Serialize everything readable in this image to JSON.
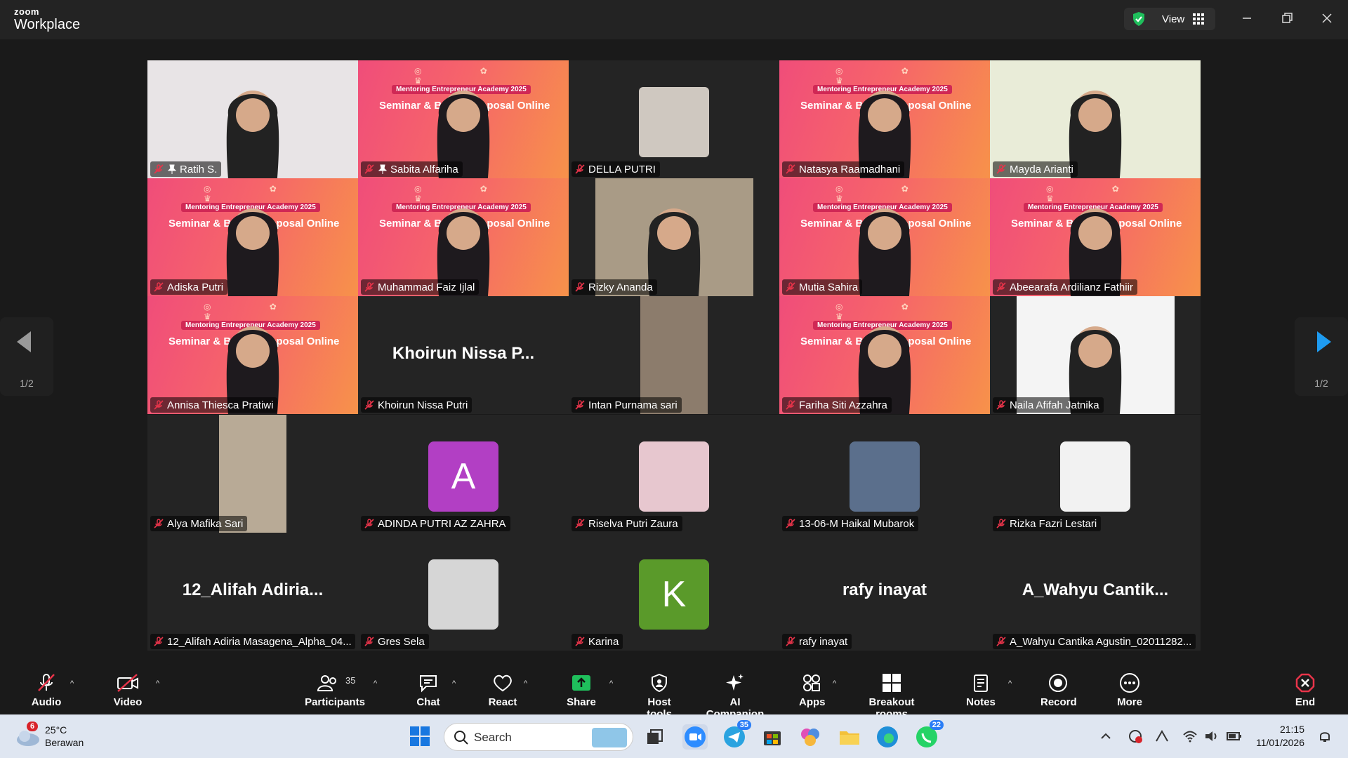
{
  "app": {
    "brand_top": "zoom",
    "brand_bottom": "Workplace",
    "view_label": "View"
  },
  "pager": {
    "left": "1/2",
    "right": "1/2"
  },
  "banner": {
    "line1": "Mentoring Entrepreneur Academy 2025",
    "line2": "Seminar & Bedah Proposal Online"
  },
  "tiles": [
    {
      "name": "Ratih S.",
      "pinned": true
    },
    {
      "name": "Sabita Alfariha",
      "pinned": true
    },
    {
      "name": "DELLA PUTRI"
    },
    {
      "name": "Natasya Raamadhani"
    },
    {
      "name": "Mayda Arianti"
    },
    {
      "name": "Adiska Putri"
    },
    {
      "name": "Muhammad Faiz Ijlal"
    },
    {
      "name": "Rizky Ananda"
    },
    {
      "name": "Mutia Sahira"
    },
    {
      "name": "Abeearafa Ardilianz Fathiir"
    },
    {
      "name": "Annisa Thiesca Pratiwi"
    },
    {
      "name": "Khoirun Nissa Putri",
      "center": "Khoirun  Nissa  P..."
    },
    {
      "name": "Intan Purnama sari"
    },
    {
      "name": "Fariha Siti Azzahra"
    },
    {
      "name": "Naila Afifah Jatnika"
    },
    {
      "name": "Alya Mafika Sari"
    },
    {
      "name": "ADINDA PUTRI AZ ZAHRA",
      "initial": "A"
    },
    {
      "name": "Riselva Putri Zaura"
    },
    {
      "name": "13-06-M Haikal Mubarok"
    },
    {
      "name": "Rizka Fazri Lestari"
    },
    {
      "name": "12_Alifah Adiria Masagena_Alpha_04...",
      "center": "12_Alifah  Adiria..."
    },
    {
      "name": "Gres Sela"
    },
    {
      "name": "Karina",
      "initial": "K"
    },
    {
      "name": "rafy inayat",
      "center": "rafy inayat"
    },
    {
      "name": "A_Wahyu Cantika Agustin_02011282...",
      "center": "A_Wahyu  Cantik..."
    }
  ],
  "toolbar": {
    "audio": "Audio",
    "video": "Video",
    "participants": "Participants",
    "participants_count": "35",
    "chat": "Chat",
    "react": "React",
    "share": "Share",
    "host_tools": "Host tools",
    "ai_companion": "AI Companion",
    "apps": "Apps",
    "breakout": "Breakout rooms",
    "notes": "Notes",
    "record": "Record",
    "more": "More",
    "end": "End"
  },
  "taskbar": {
    "temp": "25°C",
    "weather": "Berawan",
    "weather_badge": "6",
    "search_placeholder": "Search",
    "telegram_badge": "35",
    "whatsapp_badge": "22",
    "time": "21:15",
    "date": "11/01/2026"
  },
  "colors": {
    "accent_green": "#23d18b",
    "end_red": "#e8344a",
    "share_green": "#1fbf5c",
    "avatar_purple": "#b23fc4",
    "avatar_green": "#5a9a2a"
  }
}
